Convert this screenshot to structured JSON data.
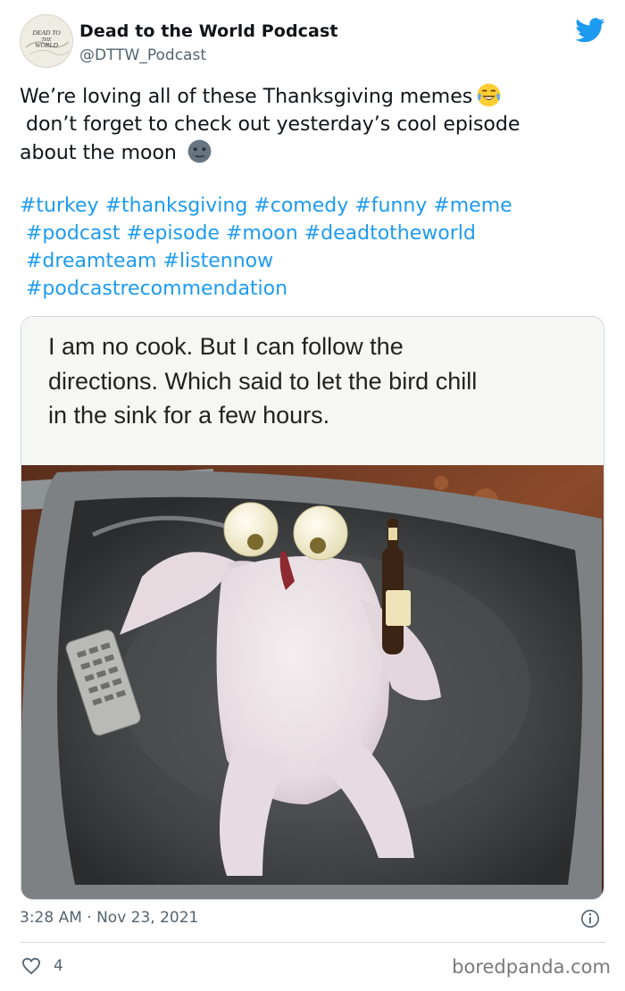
{
  "author": {
    "display_name": "Dead to the World Podcast",
    "handle": "@DTTW_Podcast",
    "avatar_text": "DEAD TO THE WORLD"
  },
  "platform_icon": "twitter-bird-icon",
  "tweet": {
    "lines": [
      "We’re loving all of these Thanksgiving memes",
      " don’t forget to check out yesterday’s cool episode",
      "about the moon"
    ],
    "emojis": [
      "face-with-tears-of-joy-emoji",
      "new-moon-face-emoji"
    ],
    "hashtag_rows": [
      [
        "#turkey",
        "#thanksgiving",
        "#comedy",
        "#funny",
        "#meme"
      ],
      [
        "#podcast",
        "#episode",
        "#moon",
        "#deadtotheworld"
      ],
      [
        "#dreamteam",
        "#listennow"
      ],
      [
        "#podcastrecommendation"
      ]
    ]
  },
  "media": {
    "caption_lines": [
      "I am no cook. But I can follow the",
      "directions. Which said to let the bird chill",
      "in the sink for a few hours."
    ],
    "photo_subject": "raw turkey posed in a sink with onion eyes, a beer bottle and a TV remote"
  },
  "footer": {
    "timestamp": "3:28 AM · Nov 23, 2021",
    "like_count": "4",
    "watermark": "boredpanda.com"
  },
  "colors": {
    "brand_blue": "#1d9bf0",
    "text_primary": "#0f1419",
    "text_secondary": "#536471",
    "border": "#cfd9de"
  }
}
